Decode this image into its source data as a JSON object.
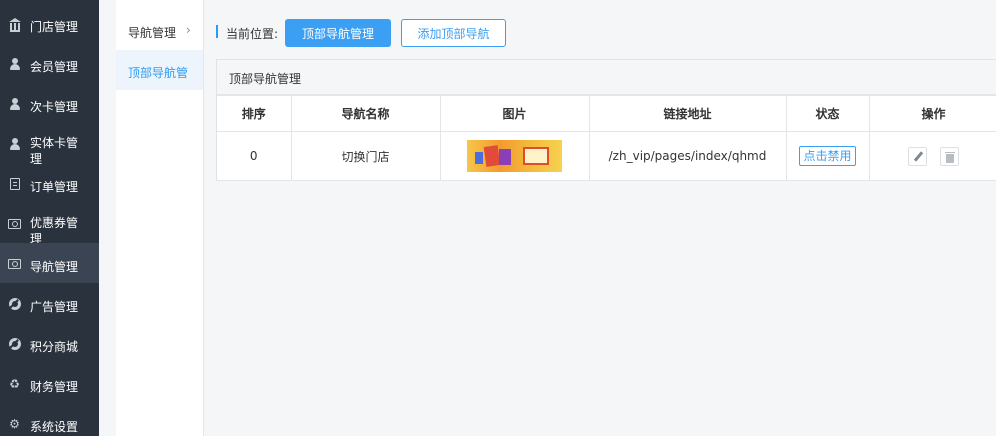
{
  "sidebar": {
    "items": [
      {
        "label": "门店管理",
        "icon": "bank-icon"
      },
      {
        "label": "会员管理",
        "icon": "user-icon"
      },
      {
        "label": "次卡管理",
        "icon": "user-icon"
      },
      {
        "label": "实体卡管理",
        "icon": "user-icon"
      },
      {
        "label": "订单管理",
        "icon": "document-icon"
      },
      {
        "label": "优惠券管理",
        "icon": "money-icon"
      },
      {
        "label": "导航管理",
        "icon": "money-icon"
      },
      {
        "label": "广告管理",
        "icon": "lifebuoy-icon"
      },
      {
        "label": "积分商城",
        "icon": "lifebuoy-icon"
      },
      {
        "label": "财务管理",
        "icon": "recycle-icon"
      },
      {
        "label": "系统设置",
        "icon": "gear-icon"
      }
    ],
    "active": "导航管理"
  },
  "subnav": {
    "parent": "导航管理",
    "active_item": "顶部导航管"
  },
  "breadcrumb": {
    "label": "当前位置:",
    "current_button": "顶部导航管理",
    "add_button": "添加顶部导航"
  },
  "panel": {
    "title": "顶部导航管理",
    "columns": [
      "排序",
      "导航名称",
      "图片",
      "链接地址",
      "状态",
      "操作"
    ],
    "rows": [
      {
        "order": "0",
        "name": "切换门店",
        "image": "banner-thumbnail",
        "link": "/zh_vip/pages/index/qhmd",
        "status_button": "点击禁用"
      }
    ]
  },
  "colors": {
    "sidebar_bg": "#29323d",
    "accent": "#3b9ff3",
    "page_bg": "#f5f6f8"
  }
}
